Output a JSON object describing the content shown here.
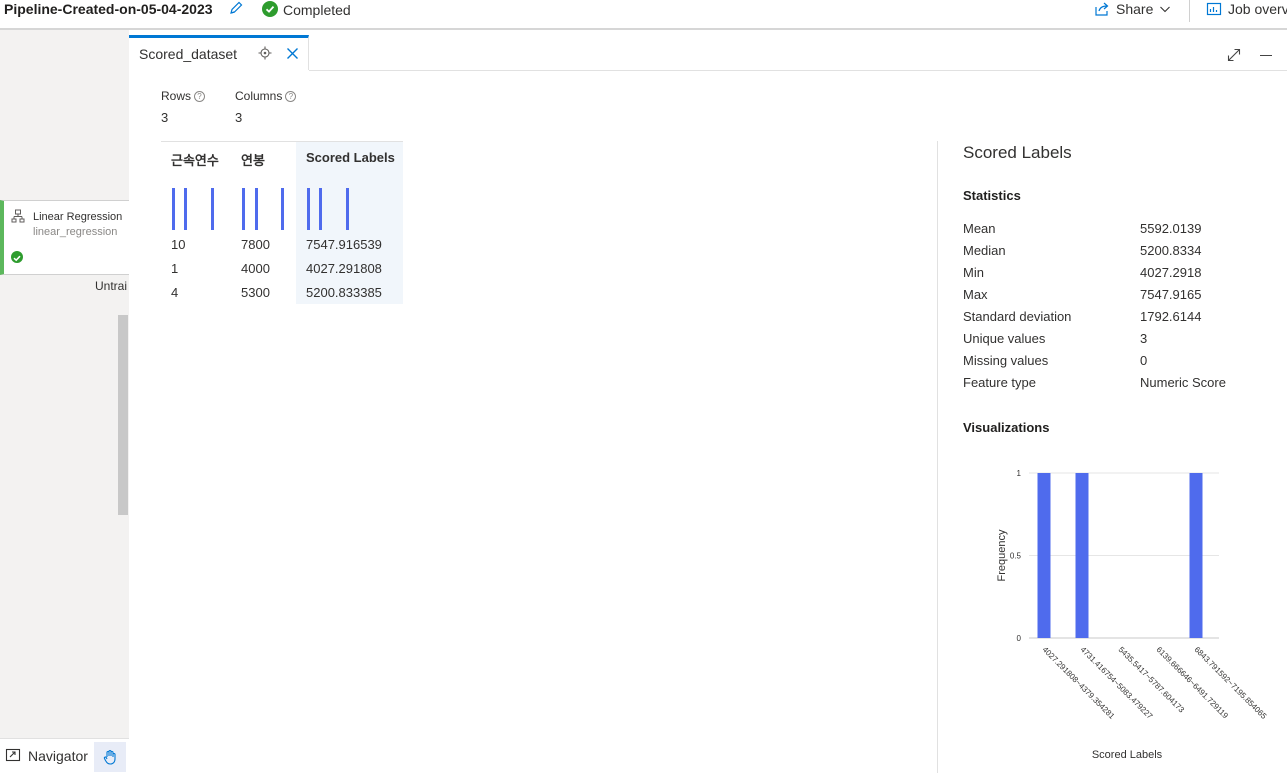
{
  "header": {
    "pipeline_title": "Pipeline-Created-on-05-04-2023",
    "status": "Completed",
    "share_label": "Share",
    "job_overview_label": "Job overv"
  },
  "canvas": {
    "module_name": "Linear Regression",
    "module_sub": "linear_regression",
    "untrained_label": "Untrai",
    "navigator_label": "Navigator"
  },
  "tab": {
    "label": "Scored_dataset"
  },
  "summary": {
    "rows_label": "Rows",
    "rows_value": "3",
    "columns_label": "Columns",
    "columns_value": "3"
  },
  "table": {
    "columns": [
      "근속연수",
      "연봉",
      "Scored Labels"
    ],
    "rows": [
      [
        "10",
        "7800",
        "7547.916539"
      ],
      [
        "1",
        "4000",
        "4027.291808"
      ],
      [
        "4",
        "5300",
        "5200.833385"
      ]
    ]
  },
  "stats": {
    "title": "Scored Labels",
    "statistics_heading": "Statistics",
    "items": [
      {
        "k": "Mean",
        "v": "5592.0139"
      },
      {
        "k": "Median",
        "v": "5200.8334"
      },
      {
        "k": "Min",
        "v": "4027.2918"
      },
      {
        "k": "Max",
        "v": "7547.9165"
      },
      {
        "k": "Standard deviation",
        "v": "1792.6144"
      },
      {
        "k": "Unique values",
        "v": "3"
      },
      {
        "k": "Missing values",
        "v": "0"
      },
      {
        "k": "Feature type",
        "v": "Numeric Score"
      }
    ],
    "visualizations_heading": "Visualizations"
  },
  "chart_data": {
    "type": "bar",
    "categories": [
      "4027.291808~4379.354281",
      "4731.416754~5083.479227",
      "5435.5417~5787.604173",
      "6139.666646~6491.729119",
      "6843.791592~7195.854065"
    ],
    "values": [
      1,
      1,
      0,
      0,
      1
    ],
    "ylabel": "Frequency",
    "xlabel": "Scored Labels",
    "yticks": [
      "0",
      "0.5",
      "1"
    ],
    "ylim": [
      0,
      1
    ],
    "color": "#4f6bed"
  }
}
